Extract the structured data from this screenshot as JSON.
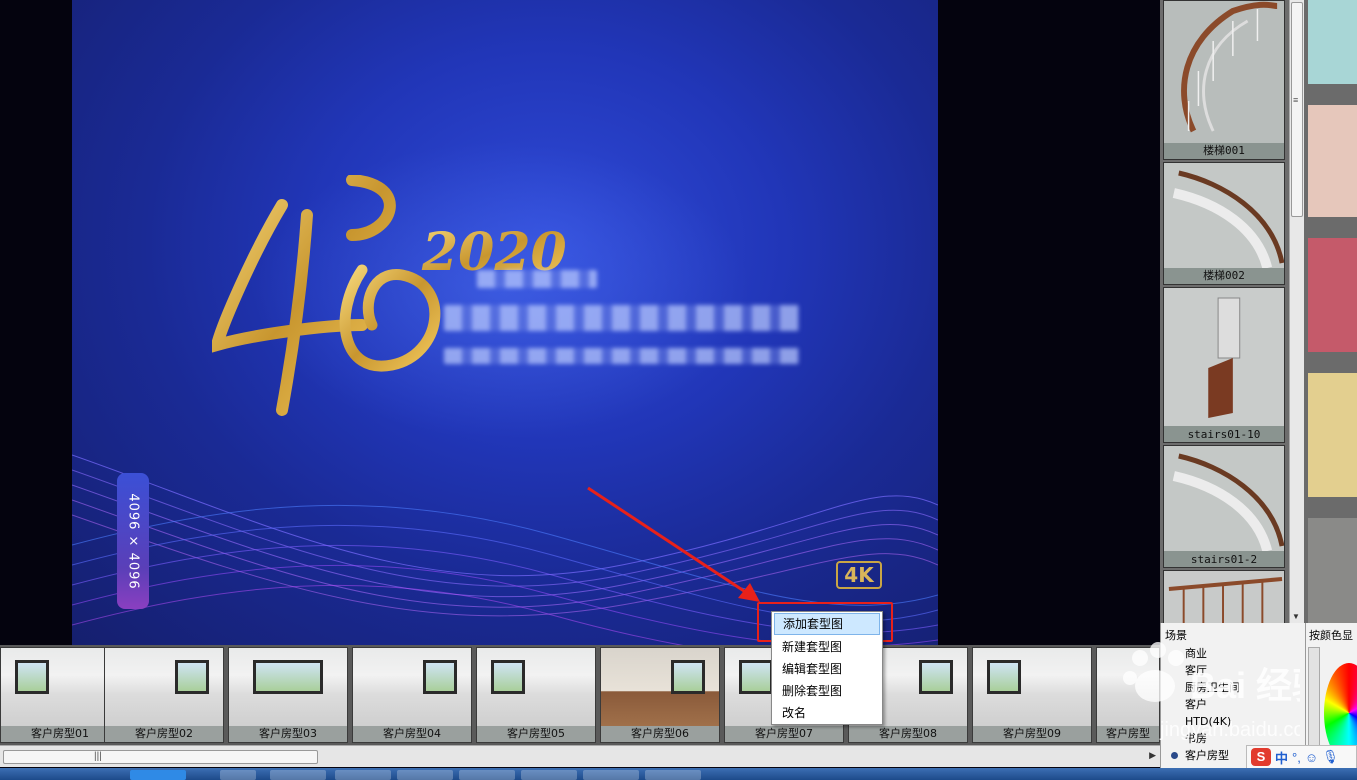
{
  "poster": {
    "year_text": "2020",
    "size_badge": "4096 × 4096",
    "res_badge": "4K"
  },
  "library": {
    "items": [
      {
        "label": "楼梯001"
      },
      {
        "label": "楼梯002"
      },
      {
        "label": "stairs01-10"
      },
      {
        "label": "stairs01-2"
      },
      {
        "label": ""
      }
    ]
  },
  "swatches": [
    "#a8d6d6",
    "#e6c7bb",
    "#c55a6a",
    "#e3cf8f",
    "#8a8a88"
  ],
  "rooms": [
    {
      "label": "客户房型01"
    },
    {
      "label": "客户房型02"
    },
    {
      "label": "客户房型03"
    },
    {
      "label": "客户房型04"
    },
    {
      "label": "客户房型05"
    },
    {
      "label": "客户房型06"
    },
    {
      "label": "客户房型07"
    },
    {
      "label": "客户房型08"
    },
    {
      "label": "客户房型09"
    },
    {
      "label": "客户房型"
    }
  ],
  "context_menu": {
    "items": [
      {
        "label": "添加套型图"
      },
      {
        "label": "新建套型图"
      },
      {
        "label": "编辑套型图"
      },
      {
        "label": "删除套型图"
      },
      {
        "label": "改名"
      }
    ]
  },
  "scene_panel": {
    "title": "场景",
    "items": [
      {
        "label": "商业"
      },
      {
        "label": "客厅"
      },
      {
        "label": "厨房卫生间"
      },
      {
        "label": "客户"
      },
      {
        "label": "HTD(4K)"
      },
      {
        "label": "书房"
      },
      {
        "label": "客户房型"
      }
    ]
  },
  "color_panel": {
    "title": "按颜色显"
  },
  "ime": {
    "logo": "S",
    "lang": "中",
    "punct": "°,"
  },
  "watermark": {
    "brand": "Bai 经验",
    "url": "jingyan.baidu.com"
  }
}
